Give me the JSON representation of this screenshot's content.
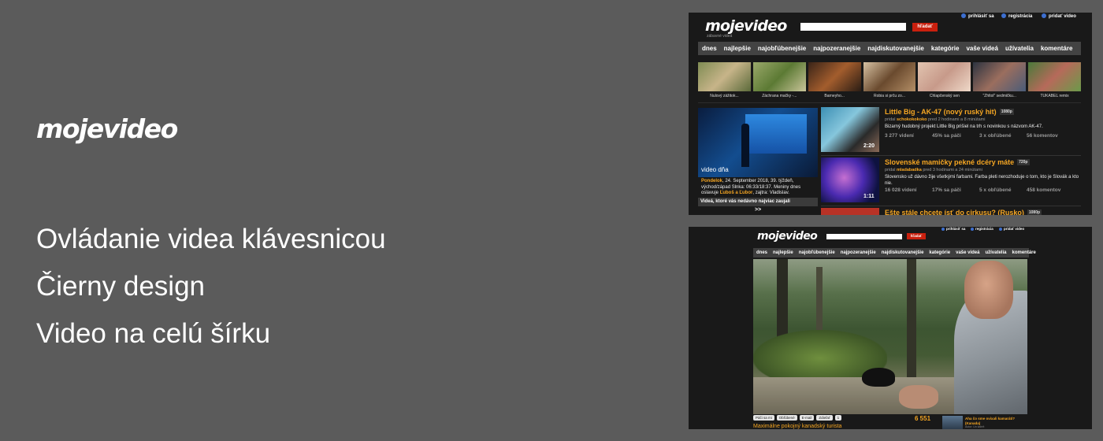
{
  "promo": {
    "logo": "mojevideo",
    "features": [
      "Ovládanie videa klávesnicou",
      "Čierny design",
      "Video na celú šírku"
    ]
  },
  "colors": {
    "background": "#5b5b5b",
    "site_bg": "#191919",
    "accent": "#f5a623",
    "search_button": "#c9200e"
  },
  "site": {
    "logo": "mojevideo",
    "tagline": "zábavné videá",
    "search_button": "hľadať",
    "user_links": [
      "prihlásiť sa",
      "registrácia",
      "pridať video"
    ],
    "nav": [
      "dnes",
      "najlepšie",
      "najobľúbenejšie",
      "najpozeranejšie",
      "najdiskutovanejšie",
      "kategórie",
      "vaše videá",
      "užívatelia",
      "komentáre"
    ]
  },
  "home": {
    "thumbnails": [
      {
        "caption": "Nulový zážitok..."
      },
      {
        "caption": "Záchrana mačky -..."
      },
      {
        "caption": "Barneyho..."
      },
      {
        "caption": "Robia si prču zo..."
      },
      {
        "caption": "Chlapčenský sen"
      },
      {
        "caption": "\"Zhltol\" sedmičku..."
      },
      {
        "caption": "TUKABEL remix"
      }
    ],
    "video_of_day": {
      "label": "video dňa",
      "day_name": "Pondelok",
      "desc_mid": ", 24. September 2018, 39. týždeň, východ/západ Slnka: 06:33/18:37. Meniny dnes oslavuje ",
      "names": "Ľuboš a Ľubor",
      "desc_end": ", zajtra: Vladislav.",
      "bar": "Videá, ktoré vás nedávno najviac zaujali",
      "more": ">>"
    },
    "items": [
      {
        "title": "Little Big - AK-47 (nový ruský hit)",
        "quality": "1080p",
        "by_prefix": "pridal",
        "author": "schokokokoko",
        "when": "pred 2 hodinami a 8 minútami",
        "desc": "Bizarný hudobný projekt Little Big prišiel na trh s novinkou s názvom AK-47.",
        "duration": "2:20",
        "stats": [
          "3 277 videní",
          "45% sa páči",
          "3 x obľúbené",
          "56 komentov"
        ]
      },
      {
        "title": "Slovenské mamičky pekné dcéry máte",
        "quality": "720p",
        "by_prefix": "pridal",
        "author": "mladabadka",
        "when": "pred 3 hodinami a 24 minútami",
        "desc": "Slovensko už dávno žije všetkými farbami. Farba pleti nerozhoduje o tom, kto je Slovák a kto nie.",
        "duration": "1:11",
        "stats": [
          "16 028 videní",
          "17% sa páči",
          "5 x obľúbené",
          "458 komentov"
        ]
      },
      {
        "title": "Ešte stále chcete ísť do cirkusu? (Rusko)",
        "quality": "1080p"
      }
    ]
  },
  "player": {
    "controls": [
      "Páči sa mi",
      "Obľúbené",
      "E-mail",
      "Zdieľať"
    ],
    "share_count": "1",
    "views": "6 551",
    "title": "Maximálne pokojný kanadský turista",
    "side_title": "Aha čo sme ovixali kamaráti? (Kanada)",
    "side_author": "Autor: Un kabrit"
  }
}
